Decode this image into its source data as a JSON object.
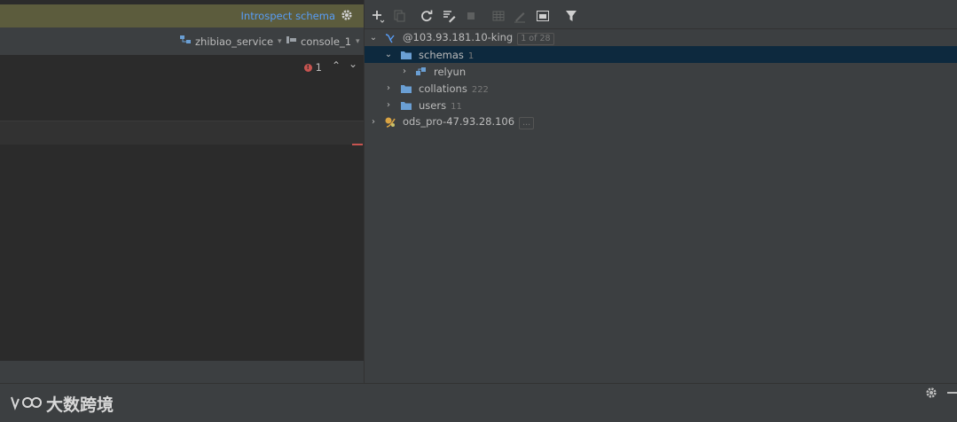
{
  "notification": {
    "link": "Introspect schema"
  },
  "context": {
    "datasource": "zhibiao_service",
    "console": "console_1"
  },
  "editor": {
    "error_count": "1"
  },
  "tree": {
    "root": {
      "label": "@103.93.181.10-king",
      "badge": "1 of 28"
    },
    "schemas": {
      "label": "schemas",
      "count": "1"
    },
    "relyun": {
      "label": "relyun"
    },
    "collations": {
      "label": "collations",
      "count": "222"
    },
    "users": {
      "label": "users",
      "count": "11"
    },
    "ods": {
      "label": "ods_pro-47.93.28.106",
      "badge": "..."
    }
  },
  "watermark": {
    "text": "大数跨境"
  },
  "colors": {
    "accent": "#589df6",
    "selection": "#0d293e",
    "folder": "#6a9fd4",
    "error": "#c75450",
    "notif_bg": "#5c5c3d"
  }
}
